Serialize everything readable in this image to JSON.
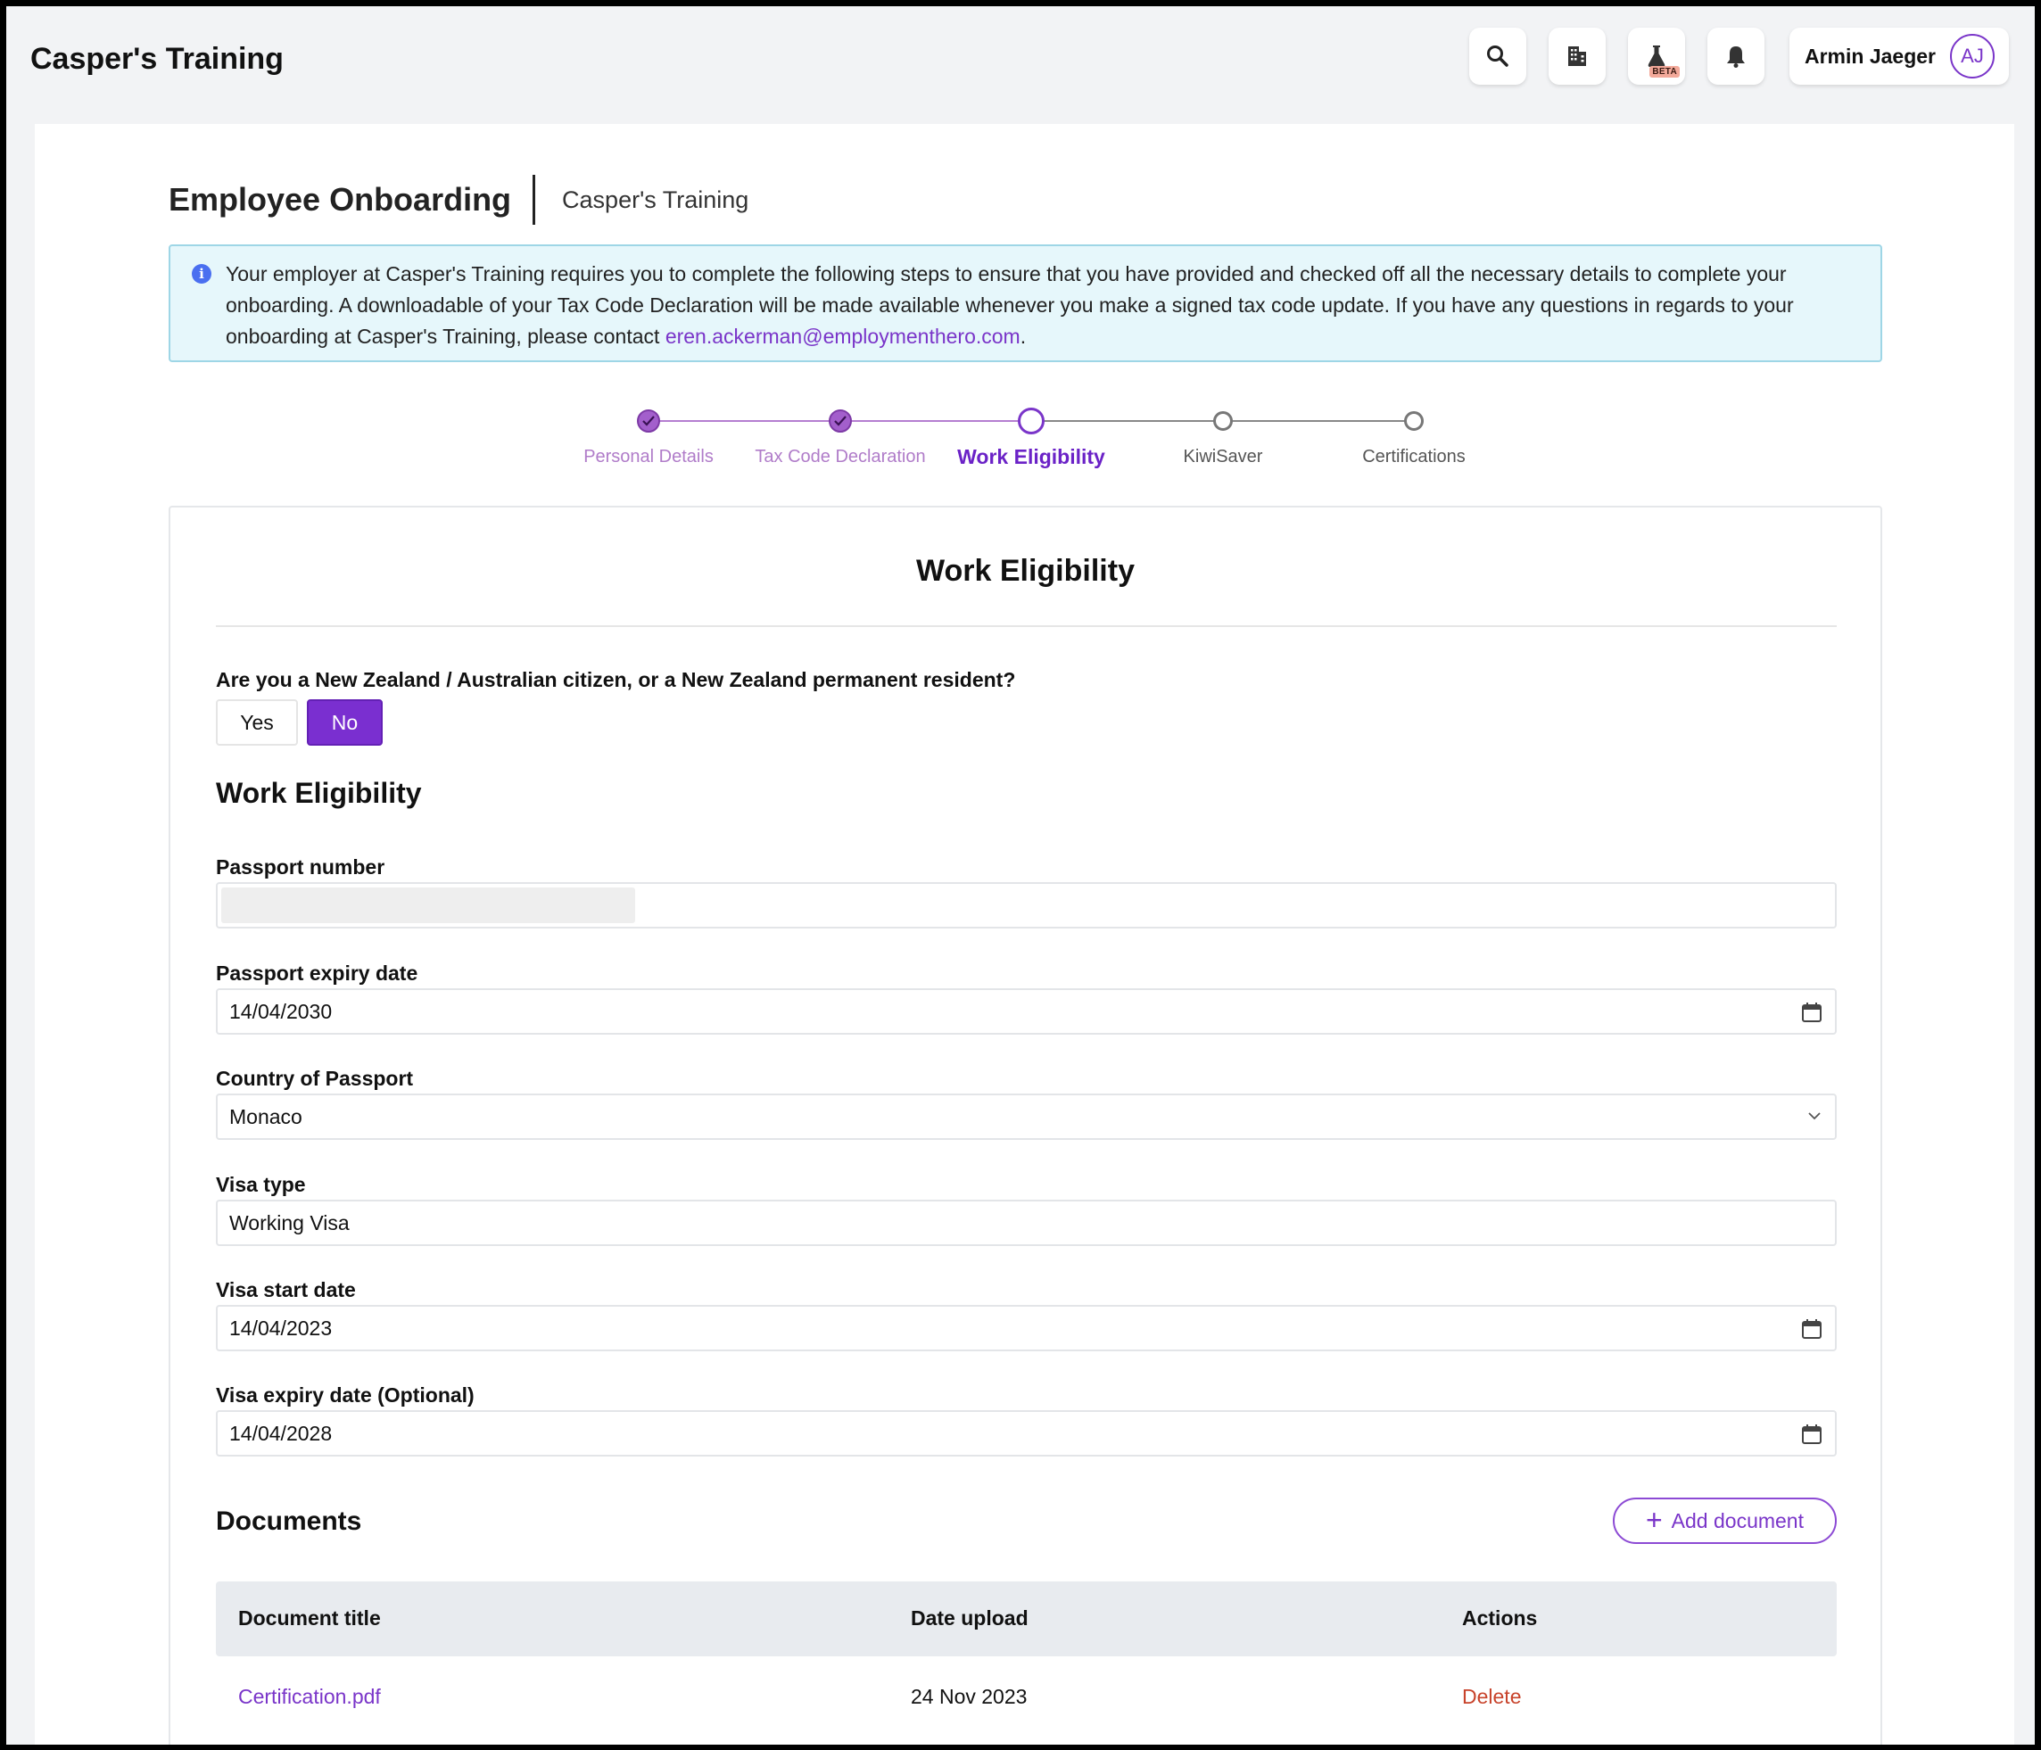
{
  "topbar": {
    "brand": "Casper's Training",
    "icons": [
      "search-icon",
      "building-icon",
      "flask-icon",
      "bell-icon"
    ],
    "beta_badge": "BETA",
    "user_name": "Armin Jaeger",
    "user_initials": "AJ"
  },
  "header": {
    "title": "Employee Onboarding",
    "subtitle": "Casper's Training"
  },
  "info": {
    "text": "Your employer at Casper's Training requires you to complete the following steps to ensure that you have provided and checked off all the necessary details to complete your onboarding. A downloadable of your Tax Code Declaration will be made available whenever you make a signed tax code update. If you have any questions in regards to your onboarding at Casper's Training, please contact ",
    "email": "eren.ackerman@employmenthero.com",
    "suffix": "."
  },
  "stepper": {
    "steps": [
      {
        "label": "Personal Details",
        "state": "done"
      },
      {
        "label": "Tax Code Declaration",
        "state": "done"
      },
      {
        "label": "Work Eligibility",
        "state": "current"
      },
      {
        "label": "KiwiSaver",
        "state": "todo"
      },
      {
        "label": "Certifications",
        "state": "todo"
      }
    ]
  },
  "form": {
    "title": "Work Eligibility",
    "question": "Are you a New Zealand / Australian citizen, or a New Zealand permanent resident?",
    "yes_label": "Yes",
    "no_label": "No",
    "selected": "No",
    "section_title": "Work Eligibility",
    "fields": {
      "passport_number": {
        "label": "Passport number",
        "value": ""
      },
      "passport_expiry": {
        "label": "Passport expiry date",
        "value": "14/04/2030"
      },
      "country": {
        "label": "Country of Passport",
        "value": "Monaco"
      },
      "visa_type": {
        "label": "Visa type",
        "value": "Working Visa"
      },
      "visa_start": {
        "label": "Visa start date",
        "value": "14/04/2023"
      },
      "visa_expiry": {
        "label": "Visa expiry date (Optional)",
        "value": "14/04/2028"
      }
    }
  },
  "documents": {
    "title": "Documents",
    "add_label": "Add document",
    "columns": [
      "Document title",
      "Date upload",
      "Actions"
    ],
    "rows": [
      {
        "title": "Certification.pdf",
        "date": "24 Nov 2023",
        "action": "Delete"
      }
    ]
  },
  "colors": {
    "accent": "#7a35c9",
    "info_bg": "#e6f7fb",
    "delete": "#c8432b"
  }
}
